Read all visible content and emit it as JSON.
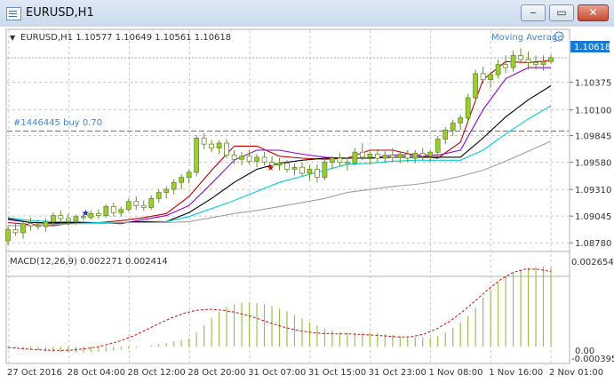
{
  "window": {
    "title": "EURUSD,H1"
  },
  "chart_header": {
    "arrow": "▼",
    "text": "EURUSD,H1  1.10577 1.10649 1.10561 1.10618"
  },
  "indicator_label": "Moving Average",
  "trade_label": "#1446445 buy 0.70",
  "current_price": "1.10618",
  "macd": {
    "label": "MACD(12,26,9) 0.002271 0.002414",
    "top_label": "0.002654",
    "zero_label": "0.00",
    "bottom_label": "-0.000395"
  },
  "chart_data": [
    {
      "type": "candlestick",
      "price_axis_labels": [
        "1.10375",
        "1.10100",
        "1.09845",
        "1.09580",
        "1.09310",
        "1.09045",
        "1.08780"
      ],
      "ylim": [
        1.0872,
        1.1075
      ],
      "time_labels": [
        "27 Oct 2016",
        "28 Oct 04:00",
        "28 Oct 12:00",
        "28 Oct 20:00",
        "31 Oct 07:00",
        "31 Oct 15:00",
        "31 Oct 23:00",
        "1 Nov 08:00",
        "1 Nov 16:00",
        "2 Nov 01:00"
      ],
      "trade_level": 1.0989,
      "current_price": 1.10618,
      "series": [
        {
          "values": [
            [
              1.088,
              1.0895,
              1.0876,
              1.0891
            ],
            [
              1.0891,
              1.0898,
              1.0885,
              1.0888
            ],
            [
              1.0888,
              1.0899,
              1.0882,
              1.0897
            ],
            [
              1.0897,
              1.0903,
              1.089,
              1.0895
            ],
            [
              1.0895,
              1.0901,
              1.0891,
              1.0894
            ],
            [
              1.0894,
              1.0902,
              1.0889,
              1.0899
            ],
            [
              1.0899,
              1.0908,
              1.0896,
              1.0905
            ],
            [
              1.0905,
              1.091,
              1.0898,
              1.0902
            ],
            [
              1.0902,
              1.0907,
              1.0895,
              1.09
            ],
            [
              1.09,
              1.0906,
              1.0896,
              1.0904
            ],
            [
              1.0904,
              1.0909,
              1.09,
              1.0903
            ],
            [
              1.0903,
              1.091,
              1.0901,
              1.0907
            ],
            [
              1.0907,
              1.0911,
              1.0902,
              1.0905
            ],
            [
              1.0905,
              1.0916,
              1.0903,
              1.0914
            ],
            [
              1.0914,
              1.0918,
              1.0904,
              1.0908
            ],
            [
              1.0908,
              1.0914,
              1.0904,
              1.0911
            ],
            [
              1.0911,
              1.0922,
              1.0909,
              1.0919
            ],
            [
              1.0919,
              1.0924,
              1.0911,
              1.0915
            ],
            [
              1.0915,
              1.092,
              1.091,
              1.0913
            ],
            [
              1.0913,
              1.0925,
              1.0911,
              1.0922
            ],
            [
              1.0922,
              1.0931,
              1.0918,
              1.0928
            ],
            [
              1.0928,
              1.0934,
              1.0922,
              1.0931
            ],
            [
              1.0931,
              1.0941,
              1.0926,
              1.0938
            ],
            [
              1.0938,
              1.0946,
              1.0931,
              1.0943
            ],
            [
              1.0943,
              1.0951,
              1.0937,
              1.0948
            ],
            [
              1.0948,
              1.0985,
              1.0944,
              1.0982
            ],
            [
              1.0982,
              1.0987,
              1.0971,
              1.0976
            ],
            [
              1.0976,
              1.098,
              1.0968,
              1.0972
            ],
            [
              1.0972,
              1.098,
              1.0966,
              1.0977
            ],
            [
              1.0977,
              1.0981,
              1.0962,
              1.0965
            ],
            [
              1.0965,
              1.097,
              1.0956,
              1.0961
            ],
            [
              1.0961,
              1.0968,
              1.0955,
              1.0964
            ],
            [
              1.0964,
              1.097,
              1.0956,
              1.0959
            ],
            [
              1.0959,
              1.0966,
              1.0953,
              1.0963
            ],
            [
              1.0963,
              1.0968,
              1.0955,
              1.0958
            ],
            [
              1.0958,
              1.0964,
              1.0952,
              1.0955
            ],
            [
              1.0955,
              1.0962,
              1.095,
              1.0957
            ],
            [
              1.0957,
              1.096,
              1.0948,
              1.0951
            ],
            [
              1.0951,
              1.0957,
              1.0945,
              1.0953
            ],
            [
              1.0953,
              1.0958,
              1.0944,
              1.0947
            ],
            [
              1.0947,
              1.0955,
              1.094,
              1.0951
            ],
            [
              1.0951,
              1.0956,
              1.0938,
              1.0943
            ],
            [
              1.0943,
              1.0962,
              1.094,
              1.0958
            ],
            [
              1.0958,
              1.0964,
              1.0951,
              1.0962
            ],
            [
              1.0962,
              1.0967,
              1.0954,
              1.0958
            ],
            [
              1.0958,
              1.0963,
              1.095,
              1.0957
            ],
            [
              1.0957,
              1.0972,
              1.0955,
              1.0968
            ],
            [
              1.0968,
              1.0977,
              1.096,
              1.0963
            ],
            [
              1.0963,
              1.0969,
              1.0956,
              1.0966
            ],
            [
              1.0966,
              1.0971,
              1.0958,
              1.0962
            ],
            [
              1.0962,
              1.0969,
              1.0957,
              1.0965
            ],
            [
              1.0965,
              1.0972,
              1.0959,
              1.0963
            ],
            [
              1.0963,
              1.0968,
              1.0957,
              1.0966
            ],
            [
              1.0966,
              1.097,
              1.0958,
              1.0962
            ],
            [
              1.0962,
              1.097,
              1.0957,
              1.0967
            ],
            [
              1.0967,
              1.0972,
              1.096,
              1.0964
            ],
            [
              1.0964,
              1.097,
              1.0958,
              1.0968
            ],
            [
              1.0968,
              1.0984,
              1.0964,
              1.0981
            ],
            [
              1.0981,
              1.0993,
              1.0976,
              1.099
            ],
            [
              1.099,
              1.1,
              1.0984,
              1.0997
            ],
            [
              1.0997,
              1.1005,
              1.099,
              1.1002
            ],
            [
              1.1002,
              1.1026,
              1.0998,
              1.1022
            ],
            [
              1.1022,
              1.105,
              1.1018,
              1.1046
            ],
            [
              1.1046,
              1.1053,
              1.1036,
              1.104
            ],
            [
              1.104,
              1.1048,
              1.1032,
              1.1045
            ],
            [
              1.1045,
              1.106,
              1.1041,
              1.1055
            ],
            [
              1.1055,
              1.1064,
              1.1047,
              1.1052
            ],
            [
              1.1052,
              1.1069,
              1.1048,
              1.1064
            ],
            [
              1.1064,
              1.1071,
              1.1056,
              1.106
            ],
            [
              1.106,
              1.1068,
              1.105,
              1.1057
            ],
            [
              1.1057,
              1.1064,
              1.105,
              1.1055
            ],
            [
              1.1055,
              1.1064,
              1.1049,
              1.1058
            ],
            [
              1.1058,
              1.1065,
              1.1056,
              1.1062
            ]
          ]
        }
      ],
      "moving_averages": [
        {
          "color": "#c00000",
          "values": [
            1.0898,
            1.0896,
            1.0895,
            1.0898,
            1.0898,
            1.09,
            1.0903,
            1.0907,
            1.0924,
            1.095,
            1.0974,
            1.0974,
            1.0964,
            1.0962,
            1.0961,
            1.0962,
            1.097,
            1.097,
            1.0965,
            1.0962,
            1.0978,
            1.104,
            1.1058,
            1.1057,
            1.1059
          ]
        },
        {
          "color": "#9400d3",
          "values": [
            1.0901,
            1.0898,
            1.0897,
            1.0898,
            1.0898,
            1.0897,
            1.0901,
            1.0905,
            1.0915,
            1.0937,
            1.096,
            1.097,
            1.097,
            1.0966,
            1.0963,
            1.0962,
            1.0962,
            1.0965,
            1.0965,
            1.0965,
            1.097,
            1.101,
            1.1041,
            1.1052,
            1.1052
          ]
        },
        {
          "color": "#000000",
          "values": [
            1.0902,
            1.0898,
            1.0898,
            1.0898,
            1.0898,
            1.0898,
            1.0899,
            1.0899,
            1.0908,
            1.0922,
            1.0938,
            1.0951,
            1.0957,
            1.096,
            1.0962,
            1.0962,
            1.0962,
            1.0963,
            1.0963,
            1.0963,
            1.0963,
            1.0982,
            1.1003,
            1.102,
            1.1034
          ]
        },
        {
          "color": "#00ced1",
          "values": [
            1.0903,
            1.09,
            1.0899,
            1.0899,
            1.0898,
            1.0898,
            1.0898,
            1.0899,
            1.0904,
            1.0912,
            1.092,
            1.0929,
            1.0938,
            1.0944,
            1.095,
            1.0956,
            1.0957,
            1.0959,
            1.096,
            1.096,
            1.096,
            1.097,
            1.0986,
            1.1001,
            1.1014
          ]
        },
        {
          "color": "#a0a0a0",
          "values": [
            1.0895,
            1.0895,
            1.0896,
            1.0897,
            1.0897,
            1.0898,
            1.0898,
            1.0898,
            1.0899,
            1.0903,
            1.0907,
            1.091,
            1.0914,
            1.0918,
            1.0922,
            1.0928,
            1.0931,
            1.0934,
            1.0936,
            1.0939,
            1.0944,
            1.095,
            1.0959,
            1.0969,
            1.0979
          ]
        }
      ]
    },
    {
      "type": "bar",
      "title": "MACD(12,26,9)",
      "ylim": [
        -0.000395,
        0.002654
      ],
      "series": [
        {
          "name": "MACD",
          "values": [
            -3e-05,
            -5e-05,
            -8e-05,
            -0.0001,
            -0.00012,
            -0.00014,
            -0.00016,
            -0.00017,
            -0.00018,
            -0.00019,
            -0.00019,
            -0.00018,
            -0.00017,
            -0.00015,
            -0.00013,
            -0.0001,
            -7e-05,
            -4e-05,
            0.0,
            4e-05,
            8e-05,
            0.00012,
            0.00017,
            0.00022,
            0.00026,
            0.00045,
            0.00068,
            0.00092,
            0.00112,
            0.00127,
            0.00136,
            0.00141,
            0.00142,
            0.0014,
            0.00136,
            0.0013,
            0.00122,
            0.00113,
            0.00102,
            0.00091,
            0.00079,
            0.00068,
            0.00058,
            0.00052,
            0.00048,
            0.00045,
            0.00045,
            0.00046,
            0.00046,
            0.00044,
            0.00041,
            0.00038,
            0.00034,
            0.00031,
            0.00029,
            0.00028,
            0.00029,
            0.00034,
            0.00045,
            0.00061,
            0.00078,
            0.00098,
            0.00125,
            0.00158,
            0.00185,
            0.00207,
            0.00225,
            0.00237,
            0.00247,
            0.00253,
            0.00256,
            0.00257,
            0.00255
          ]
        },
        {
          "name": "Signal",
          "values": [
            -3e-05,
            -6e-05,
            -9e-05,
            -0.00011,
            -0.00012,
            -0.00011,
            -7e-05,
            -1e-05,
            8e-05,
            0.0002,
            0.00036,
            0.00055,
            0.00075,
            0.00093,
            0.00108,
            0.00117,
            0.0012,
            0.00117,
            0.0011,
            0.001,
            0.00087,
            0.00073,
            0.00061,
            0.00052,
            0.00046,
            0.00042,
            0.00041,
            0.00041,
            0.00039,
            0.00037,
            0.00034,
            0.00031,
            0.00032,
            0.00041,
            0.00058,
            0.00082,
            0.00112,
            0.00147,
            0.00183,
            0.00215,
            0.00238,
            0.00249,
            0.00248,
            0.00241
          ]
        }
      ]
    }
  ]
}
